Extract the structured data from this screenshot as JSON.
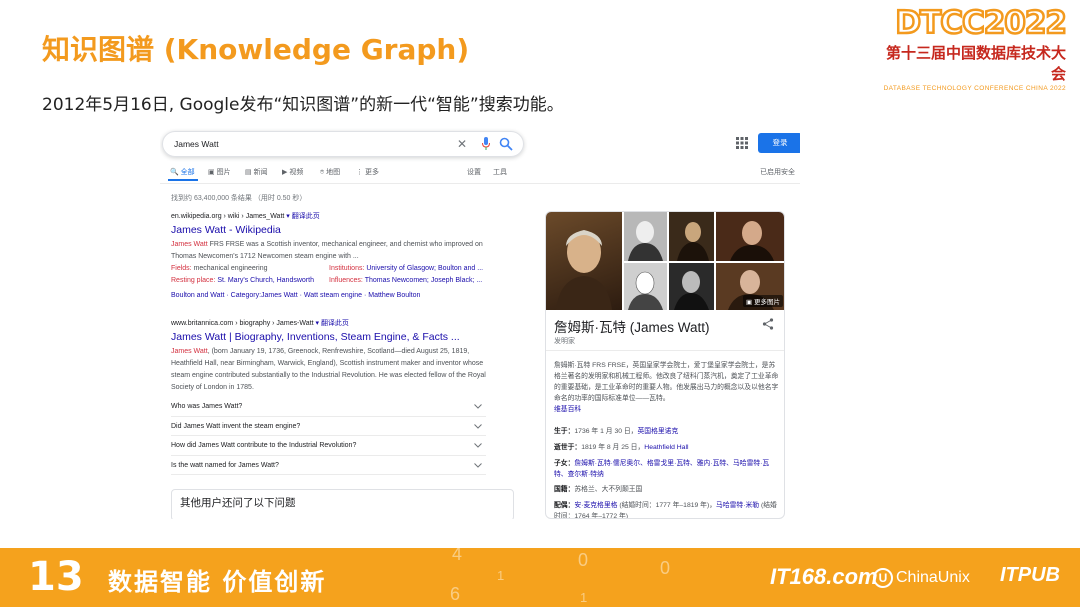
{
  "slide": {
    "title": "知识图谱 (Knowledge Graph)",
    "subtitle": "2012年5月16日, Google发布“知识图谱”的新一代“智能”搜索功能。"
  },
  "logo": {
    "main": "DTCC2022",
    "chinese": "第十三届中国数据库技术大会",
    "english": "DATABASE TECHNOLOGY CONFERENCE CHINA 2022"
  },
  "google": {
    "query": "James Watt",
    "signin_label": "登录",
    "tabs": [
      "全部",
      "图片",
      "新闻",
      "视频",
      "地图",
      "更多"
    ],
    "settings_label": "设置",
    "tools_label": "工具",
    "safe_search": "已启用安全",
    "stats": "找到约 63,400,000 条结果 （用时 0.50 秒）",
    "result1": {
      "cite": "en.wikipedia.org › wiki › James_Watt",
      "translate": "翻译此页",
      "title": "James Watt - Wikipedia",
      "snippet_name": "James Watt",
      "snippet": " FRS FRSE was a Scottish inventor, mechanical engineer, and chemist who improved on Thomas Newcomen's 1712 Newcomen steam engine with ...",
      "facts": [
        {
          "k": "Fields: ",
          "v": "mechanical engineering"
        },
        {
          "k": "Institutions: ",
          "v": "University of Glasgow; Boulton and ..."
        },
        {
          "k": "Resting place: ",
          "v": "St. Mary's Church, Handsworth"
        },
        {
          "k": "Influences: ",
          "v": "Thomas Newcomen; Joseph Black; ..."
        }
      ],
      "sitelinks": "Boulton and Watt · Category:James Watt · Watt steam engine · Matthew Boulton"
    },
    "result2": {
      "cite": "www.britannica.com › biography › James-Watt",
      "translate": "翻译此页",
      "title": "James Watt | Biography, Inventions, Steam Engine, & Facts ...",
      "snippet_name": "James Watt",
      "snippet": ", (born January 19, 1736, Greenock, Renfrewshire, Scotland—died August 25, 1819, Heathfield Hall, near Birmingham, Warwick, England), Scottish instrument maker and inventor whose steam engine contributed substantially to the Industrial Revolution. He was elected fellow of the Royal Society of London in 1785."
    },
    "questions": [
      "Who was James Watt?",
      "Did James Watt invent the steam engine?",
      "How did James Watt contribute to the Industrial Revolution?",
      "Is the watt named for James Watt?"
    ],
    "other_questions": "其他用户还问了以下问题",
    "kp": {
      "more_images": "更多图片",
      "title": "詹姆斯·瓦特 (James Watt)",
      "subtitle": "发明家",
      "description": "詹姆斯·瓦特 FRS FRSE，英国皇家学会院士，爱丁堡皇家学会院士，是苏格兰著名的发明家和机械工程师。他改良了纽科门蒸汽机，奠定了工业革命的重要基础，是工业革命时的重要人物。他发展出马力的概念以及以他名字命名的功率的国际标准单位——瓦特。",
      "source": "维基百科",
      "born_label": "生于：",
      "born_text": "1736 年 1 月 30 日，",
      "born_place": "英国格里诺克",
      "died_label": "逝世于：",
      "died_text": "1819 年 8 月 25 日，",
      "died_place": "Heathfield Hall",
      "children_label": "子女：",
      "children": "詹姆斯·瓦特·儒尼奥尔、格雷戈里·瓦特、雅内·瓦特、马哈雷特·瓦特、查尔斯·特纳",
      "nationality_label": "国籍：",
      "nationality": "苏格兰、大不列颠王国",
      "spouse_label": "配偶：",
      "spouse1": "安·麦克格里格",
      "spouse1_years": " (结婚时间：1777 年–1819 年)，",
      "spouse2": "马哈雷特·米勒",
      "spouse2_years": " (结婚时间：1764 年–1772 年)"
    }
  },
  "banner": {
    "number": "13",
    "slogan": "数据智能  价值创新",
    "it168": "IT168.com",
    "chinaunix": "ChinaUnix",
    "itpub": "ITPUB",
    "deco": [
      "4",
      "0",
      "1",
      "0",
      "6",
      "1"
    ]
  }
}
